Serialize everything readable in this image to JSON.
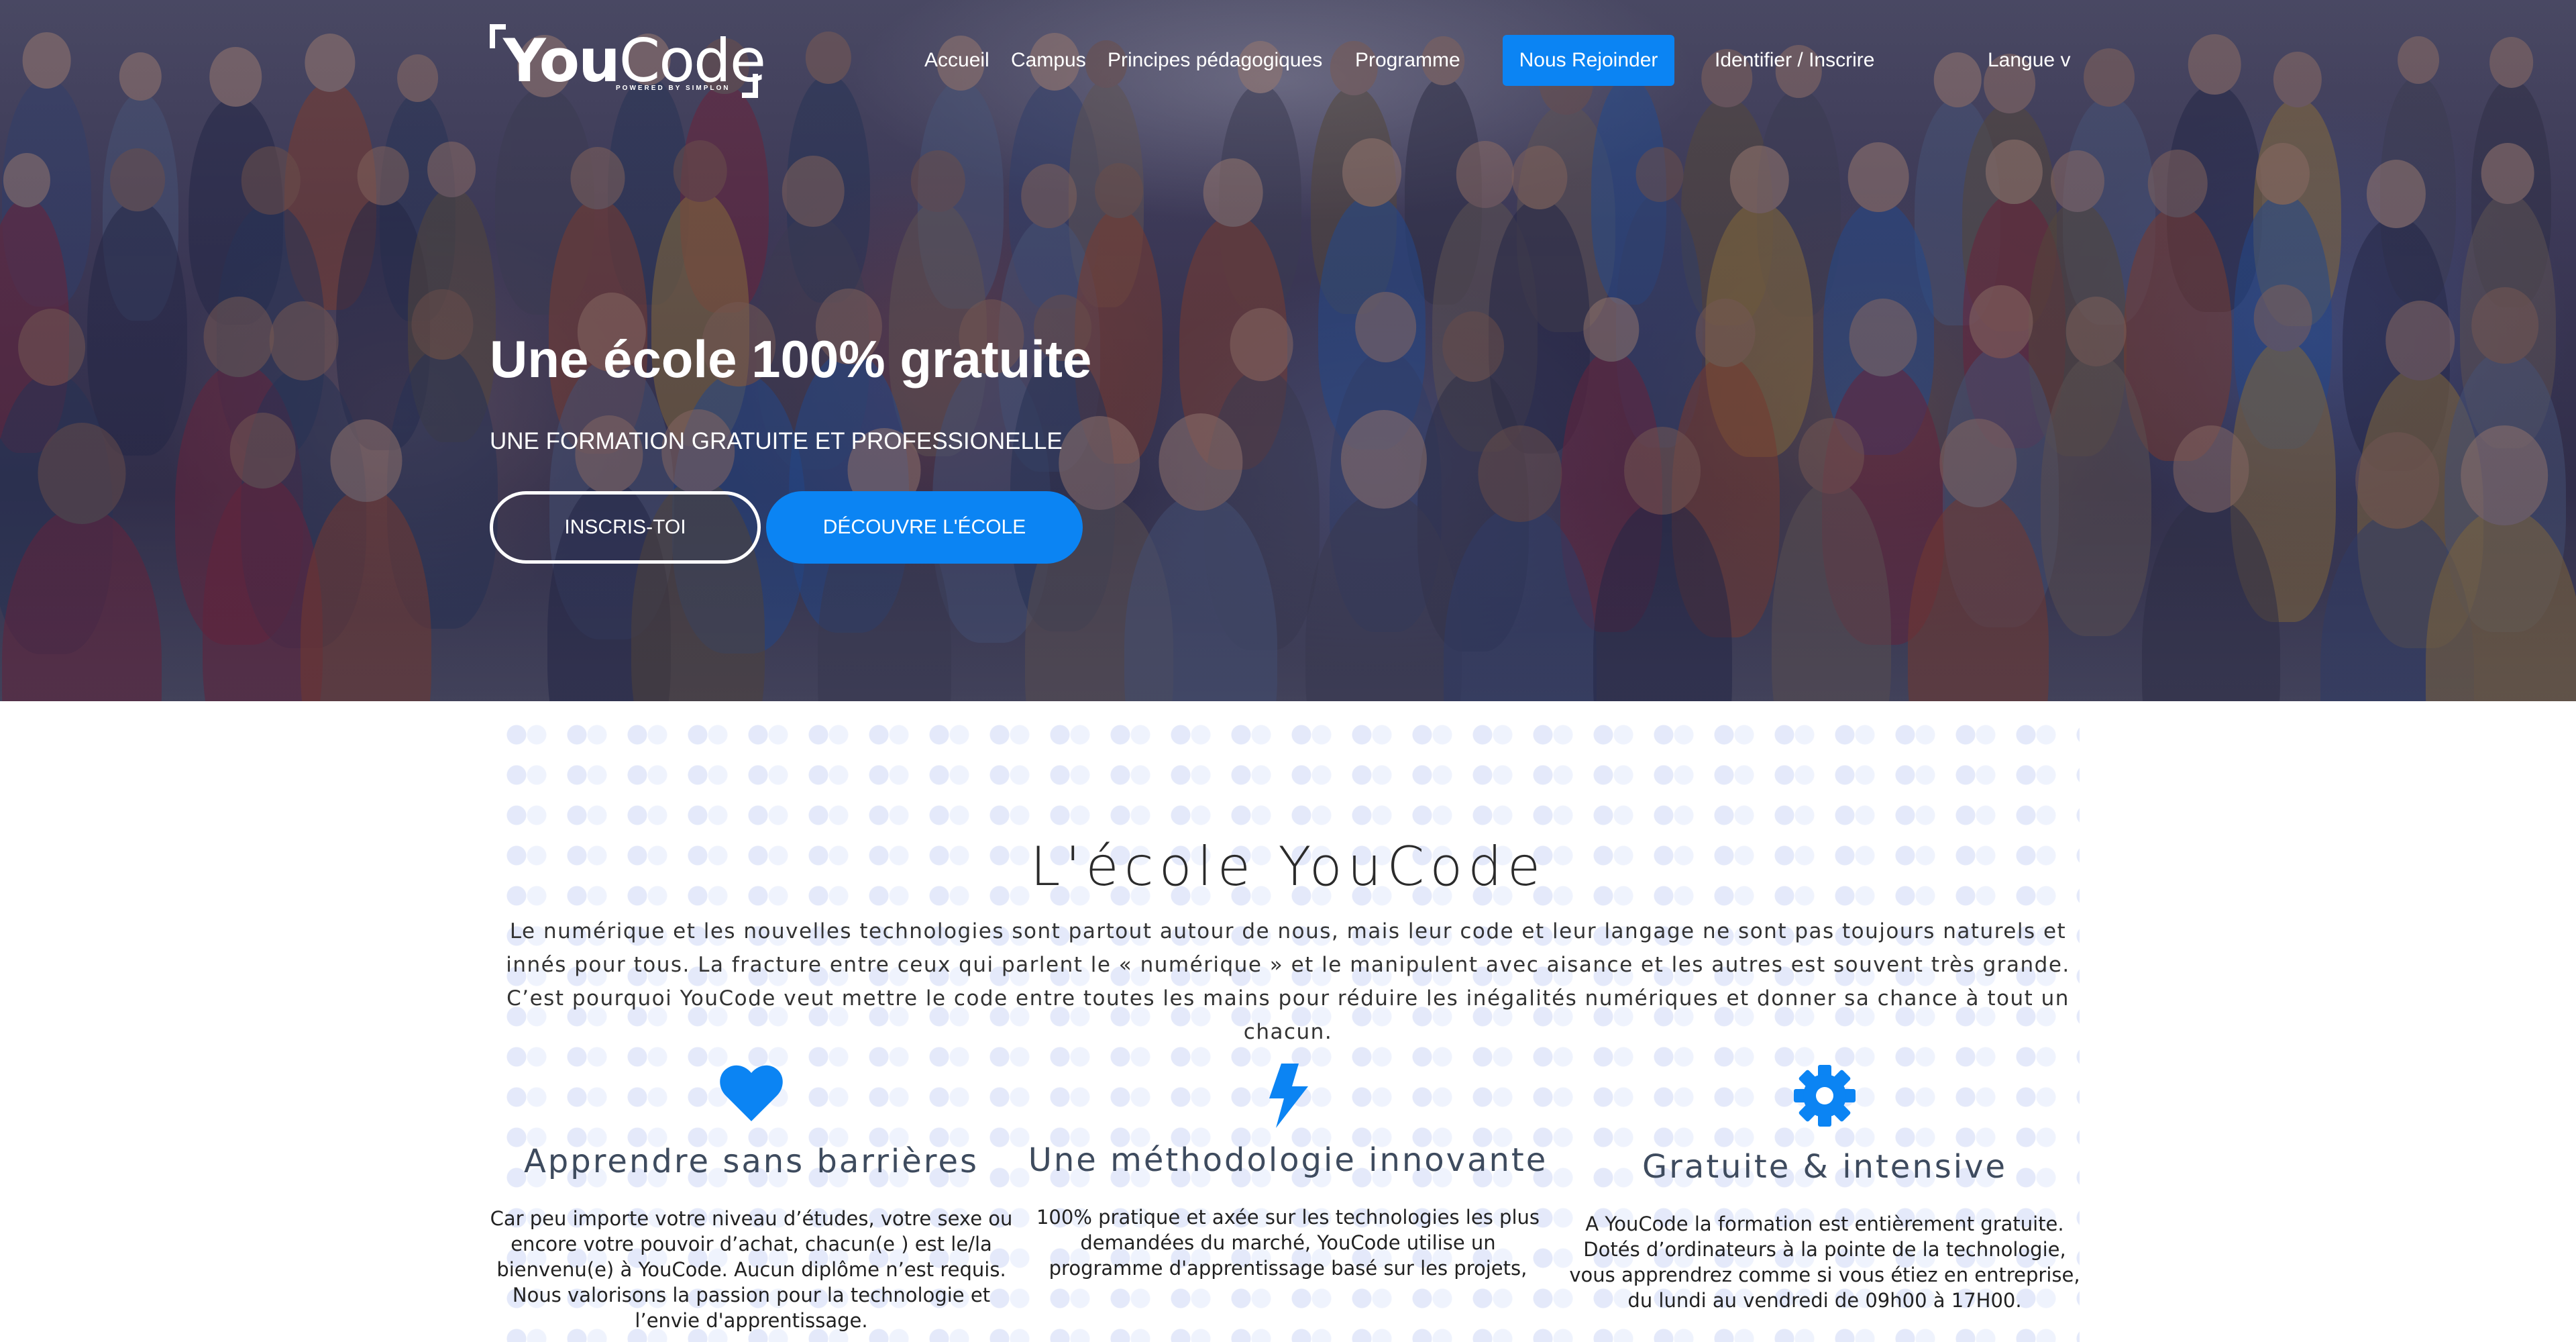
{
  "brand": {
    "logo_text_bold": "You",
    "logo_text_regular": "Code",
    "logo_tagline": "POWERED BY SIMPLON",
    "accent_color": "#0b84f3"
  },
  "nav": {
    "items": [
      {
        "label": "Accueil"
      },
      {
        "label": "Campus"
      },
      {
        "label": "Principes pédagogiques"
      },
      {
        "label": "Programme"
      }
    ],
    "cta_label": "Nous Rejoinder",
    "login_label": "Identifier / Inscrire",
    "language_label": "Langue v"
  },
  "hero": {
    "title": "Une école 100% gratuite",
    "subtitle": "UNE FORMATION GRATUITE ET PROFESSIONELLE",
    "btn_primary": "INSCRIS-TOI",
    "btn_secondary": "DÉCOUVRE L'ÉCOLE"
  },
  "about": {
    "title": "L'école YouCode",
    "text": "Le numérique et les nouvelles technologies sont partout autour de nous, mais leur code et leur langage ne sont pas toujours naturels et innés pour tous. La fracture entre ceux qui parlent le « numérique » et le manipulent avec aisance et les autres est souvent très grande. C’est pourquoi YouCode veut mettre le code entre toutes les mains pour réduire les inégalités numériques et donner sa chance à tout un chacun.",
    "features": [
      {
        "icon": "heart-icon",
        "title": "Apprendre sans barrières",
        "text": "Car peu importe votre niveau d’études, votre sexe ou encore votre pouvoir d’achat, chacun(e ) est le/la bienvenu(e) à YouCode. Aucun diplôme n’est requis. Nous valorisons la passion pour la technologie et l’envie d'apprentissage."
      },
      {
        "icon": "bolt-icon",
        "title": "Une méthodologie innovante",
        "text": "100% pratique et axée sur les technologies les plus demandées du marché, YouCode utilise un programme d'apprentissage basé sur les projets,"
      },
      {
        "icon": "gear-icon",
        "title": "Gratuite & intensive",
        "text": "A YouCode la formation est entièrement gratuite. Dotés d’ordinateurs à la pointe de la technologie, vous apprendrez comme si vous étiez en entreprise, du lundi au vendredi de 09h00 à 17H00."
      }
    ]
  }
}
